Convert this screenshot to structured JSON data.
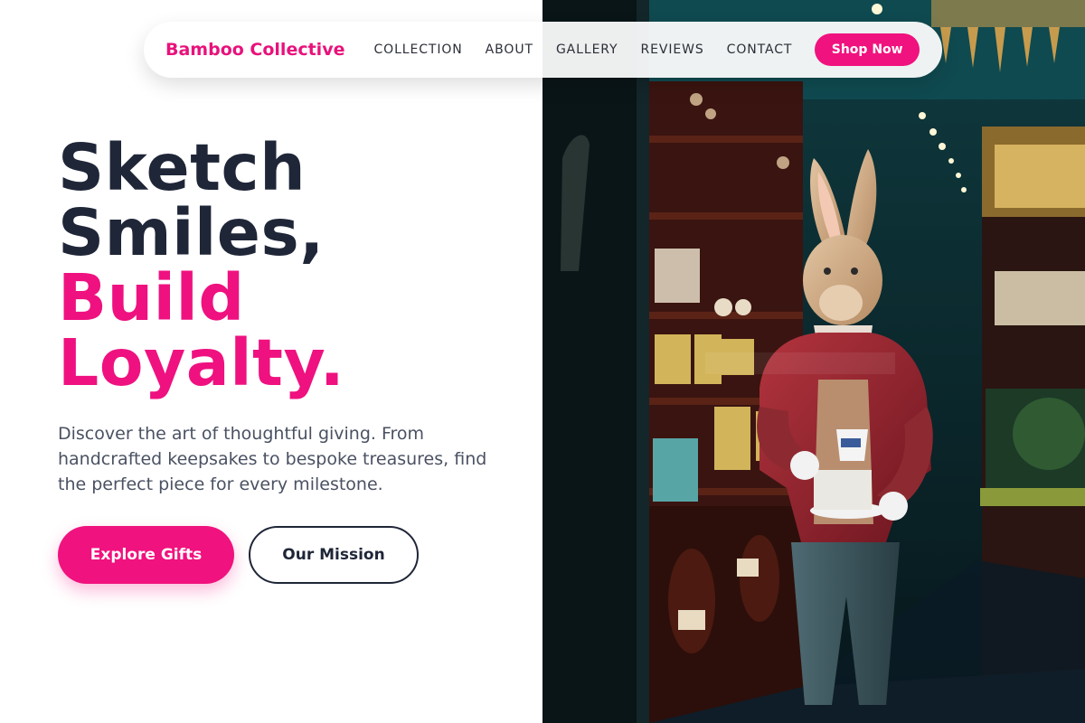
{
  "brand": {
    "name": "Bamboo Collective",
    "color": "#e8127b"
  },
  "nav": {
    "links": [
      "COLLECTION",
      "ABOUT",
      "GALLERY",
      "REVIEWS",
      "CONTACT"
    ],
    "cta_label": "Shop Now"
  },
  "hero": {
    "title_line1": "Sketch",
    "title_line2": "Smiles,",
    "title_line3": "Build",
    "title_line4": "Loyalty.",
    "subtitle": "Discover the art of thoughtful giving. From handcrafted keepsakes to bespoke treasures, find the perfect piece for every milestone.",
    "primary_button": "Explore Gifts",
    "secondary_button": "Our Mission"
  },
  "hero_image": {
    "subject": "rabbit statue in red coat holding a teacup inside a tea shop"
  },
  "colors": {
    "accent": "#f0127e",
    "heading_dark": "#1f2638",
    "body_text": "#4a5162"
  }
}
